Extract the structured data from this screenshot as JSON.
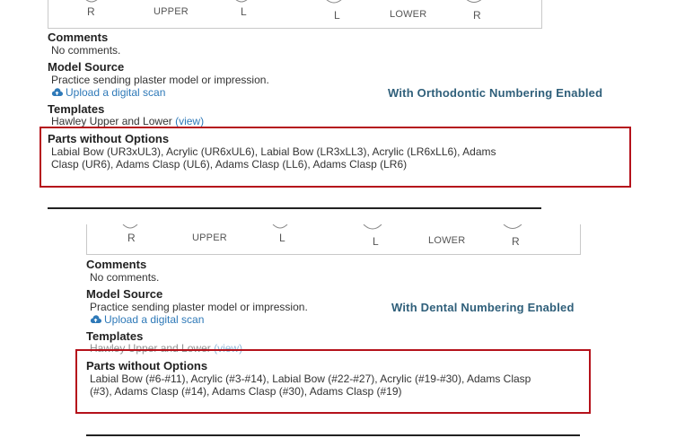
{
  "top": {
    "chart": {
      "r_left": "R",
      "upper": "UPPER",
      "l_upper": "L",
      "l_lower": "L",
      "lower": "LOWER",
      "r_right": "R"
    },
    "comments_label": "Comments",
    "comments_value": "No comments.",
    "model_source_label": "Model Source",
    "model_source_value": "Practice sending plaster model or impression.",
    "upload_link": "Upload a digital scan",
    "caption": "With Orthodontic Numbering Enabled",
    "templates_label": "Templates",
    "templates_value": "Hawley Upper and Lower",
    "templates_view": "(view)",
    "parts_label": "Parts without Options",
    "parts_line1": "Labial Bow (UR3xUL3), Acrylic (UR6xUL6), Labial Bow (LR3xLL3), Acrylic (LR6xLL6), Adams",
    "parts_line2": "Clasp (UR6), Adams Clasp (UL6), Adams Clasp (LL6), Adams Clasp (LR6)"
  },
  "bottom": {
    "chart": {
      "r_left": "R",
      "upper": "UPPER",
      "l_upper": "L",
      "l_lower": "L",
      "lower": "LOWER",
      "r_right": "R"
    },
    "comments_label": "Comments",
    "comments_value": "No comments.",
    "model_source_label": "Model Source",
    "model_source_value": "Practice sending plaster model or impression.",
    "upload_link": "Upload a digital scan",
    "caption": "With Dental Numbering Enabled",
    "templates_label": "Templates",
    "templates_value": "Hawley Upper and Lower",
    "templates_view": "(view)",
    "parts_label": "Parts without Options",
    "parts_line1": "Labial Bow (#6-#11), Acrylic (#3-#14), Labial Bow (#22-#27), Acrylic (#19-#30), Adams Clasp",
    "parts_line2": "(#3), Adams Clasp (#14), Adams Clasp (#30), Adams Clasp (#19)"
  },
  "colors": {
    "accent_link": "#2e79b8",
    "caption": "#2f5f7a",
    "highlight_box": "#b5121b"
  },
  "icons": {
    "upload": "cloud-upload-icon",
    "tooth": "tooth-outline-icon"
  }
}
